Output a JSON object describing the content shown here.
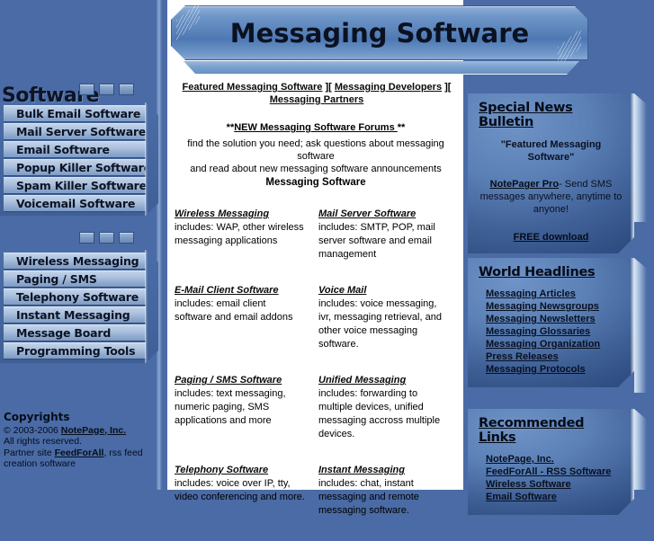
{
  "page": {
    "banner_title": "Messaging Software",
    "background_color": "#4a6ba5",
    "accent_color": "#5b80b6"
  },
  "sidebar": {
    "title": "Software",
    "menu_one": [
      {
        "label": "Bulk Email Software"
      },
      {
        "label": "Mail Server Software"
      },
      {
        "label": "Email Software"
      },
      {
        "label": "Popup Killer Software"
      },
      {
        "label": "Spam Killer Software"
      },
      {
        "label": "Voicemail Software"
      }
    ],
    "menu_two": [
      {
        "label": "Wireless Messaging"
      },
      {
        "label": "Paging / SMS"
      },
      {
        "label": "Telephony Software"
      },
      {
        "label": "Instant Messaging"
      },
      {
        "label": "Message Board"
      },
      {
        "label": "Programming Tools"
      }
    ],
    "copyright": {
      "heading": "Copyrights",
      "line1_prefix": "© 2003-2006 ",
      "line1_link": "NotePage, Inc.",
      "line2": "All rights reserved.",
      "line3_prefix": "Partner site ",
      "line3_link": "FeedForAll",
      "line3_suffix": ", rss feed creation software"
    }
  },
  "nav": {
    "links": [
      {
        "label": "Featured Messaging Software"
      },
      {
        "label": "Messaging Developers"
      },
      {
        "label": "Messaging Partners"
      }
    ],
    "separator": "]["
  },
  "forums": {
    "prefix": "**",
    "link": "NEW Messaging Software Forums ",
    "suffix": "**",
    "body_line1": "find the solution you need; ask questions about messaging software",
    "body_line2": "and read about new messaging software announcements"
  },
  "section_heading": "Messaging Software",
  "categories": [
    {
      "title": "Wireless Messaging ",
      "description": "includes: WAP, other wireless messaging applications"
    },
    {
      "title": "Mail Server Software ",
      "description": "includes: SMTP, POP, mail server software and email management"
    },
    {
      "title": "E-Mail Client Software",
      "description": "includes: email client software and email addons"
    },
    {
      "title": "Voice Mail ",
      "description": "includes: voice messaging, ivr, messaging retrieval, and other voice messaging software."
    },
    {
      "title": "Paging / SMS Software",
      "description": "includes: text messaging, numeric paging, SMS applications and more"
    },
    {
      "title": "Unified Messaging ",
      "description": "includes: forwarding to multiple devices, unified messaging accross multiple devices."
    },
    {
      "title": "Telephony Software ",
      "description": "includes: voice over IP, tty, video conferencing and more."
    },
    {
      "title": "Instant Messaging ",
      "description": "includes: chat, instant messaging and remote messaging software."
    }
  ],
  "panels": {
    "news": {
      "heading": "Special News Bulletin",
      "featured_line1": "\"Featured Messaging",
      "featured_line2": "Software\"",
      "product_link": "NotePager Pro",
      "product_text": "- Send SMS messages anywhere, anytime to anyone!",
      "download_link": "FREE download"
    },
    "world": {
      "heading": "World Headlines",
      "items": [
        {
          "label": "Messaging Articles"
        },
        {
          "label": "Messaging Newsgroups"
        },
        {
          "label": "Messaging Newsletters"
        },
        {
          "label": "Messaging Glossaries"
        },
        {
          "label": "Messaging Organization "
        },
        {
          "label": "Press Releases"
        },
        {
          "label": "Messaging Protocols"
        }
      ]
    },
    "links": {
      "heading": "Recommended Links",
      "items": [
        {
          "label": "NotePage, Inc."
        },
        {
          "label": "FeedForAll - RSS Software"
        },
        {
          "label": "Wireless Software"
        },
        {
          "label": "Email Software"
        }
      ]
    }
  }
}
